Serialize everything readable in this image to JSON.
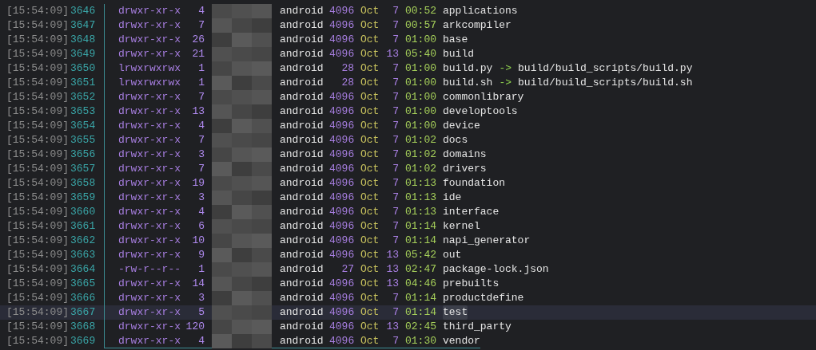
{
  "rows": [
    {
      "time": "[15:54:09]",
      "line": "3646",
      "perms": "drwxr-xr-x",
      "links": "4",
      "owner": "android",
      "size": "4096",
      "month": "Oct",
      "day": "7",
      "clock": "00:52",
      "name": "applications",
      "selected": false
    },
    {
      "time": "[15:54:09]",
      "line": "3647",
      "perms": "drwxr-xr-x",
      "links": "7",
      "owner": "android",
      "size": "4096",
      "month": "Oct",
      "day": "7",
      "clock": "00:57",
      "name": "arkcompiler",
      "selected": false
    },
    {
      "time": "[15:54:09]",
      "line": "3648",
      "perms": "drwxr-xr-x",
      "links": "26",
      "owner": "android",
      "size": "4096",
      "month": "Oct",
      "day": "7",
      "clock": "01:00",
      "name": "base",
      "selected": false
    },
    {
      "time": "[15:54:09]",
      "line": "3649",
      "perms": "drwxr-xr-x",
      "links": "21",
      "owner": "android",
      "size": "4096",
      "month": "Oct",
      "day": "13",
      "clock": "05:40",
      "name": "build",
      "selected": false
    },
    {
      "time": "[15:54:09]",
      "line": "3650",
      "perms": "lrwxrwxrwx",
      "links": "1",
      "owner": "android",
      "size": "28",
      "month": "Oct",
      "day": "7",
      "clock": "01:00",
      "name": "build.py",
      "arrow": "->",
      "target": "build/build_scripts/build.py",
      "selected": false
    },
    {
      "time": "[15:54:09]",
      "line": "3651",
      "perms": "lrwxrwxrwx",
      "links": "1",
      "owner": "android",
      "size": "28",
      "month": "Oct",
      "day": "7",
      "clock": "01:00",
      "name": "build.sh",
      "arrow": "->",
      "target": "build/build_scripts/build.sh",
      "selected": false
    },
    {
      "time": "[15:54:09]",
      "line": "3652",
      "perms": "drwxr-xr-x",
      "links": "7",
      "owner": "android",
      "size": "4096",
      "month": "Oct",
      "day": "7",
      "clock": "01:00",
      "name": "commonlibrary",
      "selected": false
    },
    {
      "time": "[15:54:09]",
      "line": "3653",
      "perms": "drwxr-xr-x",
      "links": "13",
      "owner": "android",
      "size": "4096",
      "month": "Oct",
      "day": "7",
      "clock": "01:00",
      "name": "developtools",
      "selected": false
    },
    {
      "time": "[15:54:09]",
      "line": "3654",
      "perms": "drwxr-xr-x",
      "links": "4",
      "owner": "android",
      "size": "4096",
      "month": "Oct",
      "day": "7",
      "clock": "01:00",
      "name": "device",
      "selected": false
    },
    {
      "time": "[15:54:09]",
      "line": "3655",
      "perms": "drwxr-xr-x",
      "links": "7",
      "owner": "android",
      "size": "4096",
      "month": "Oct",
      "day": "7",
      "clock": "01:02",
      "name": "docs",
      "selected": false
    },
    {
      "time": "[15:54:09]",
      "line": "3656",
      "perms": "drwxr-xr-x",
      "links": "3",
      "owner": "android",
      "size": "4096",
      "month": "Oct",
      "day": "7",
      "clock": "01:02",
      "name": "domains",
      "selected": false
    },
    {
      "time": "[15:54:09]",
      "line": "3657",
      "perms": "drwxr-xr-x",
      "links": "7",
      "owner": "android",
      "size": "4096",
      "month": "Oct",
      "day": "7",
      "clock": "01:02",
      "name": "drivers",
      "selected": false
    },
    {
      "time": "[15:54:09]",
      "line": "3658",
      "perms": "drwxr-xr-x",
      "links": "19",
      "owner": "android",
      "size": "4096",
      "month": "Oct",
      "day": "7",
      "clock": "01:13",
      "name": "foundation",
      "selected": false
    },
    {
      "time": "[15:54:09]",
      "line": "3659",
      "perms": "drwxr-xr-x",
      "links": "3",
      "owner": "android",
      "size": "4096",
      "month": "Oct",
      "day": "7",
      "clock": "01:13",
      "name": "ide",
      "selected": false
    },
    {
      "time": "[15:54:09]",
      "line": "3660",
      "perms": "drwxr-xr-x",
      "links": "4",
      "owner": "android",
      "size": "4096",
      "month": "Oct",
      "day": "7",
      "clock": "01:13",
      "name": "interface",
      "selected": false
    },
    {
      "time": "[15:54:09]",
      "line": "3661",
      "perms": "drwxr-xr-x",
      "links": "6",
      "owner": "android",
      "size": "4096",
      "month": "Oct",
      "day": "7",
      "clock": "01:14",
      "name": "kernel",
      "selected": false
    },
    {
      "time": "[15:54:09]",
      "line": "3662",
      "perms": "drwxr-xr-x",
      "links": "10",
      "owner": "android",
      "size": "4096",
      "month": "Oct",
      "day": "7",
      "clock": "01:14",
      "name": "napi_generator",
      "selected": false
    },
    {
      "time": "[15:54:09]",
      "line": "3663",
      "perms": "drwxr-xr-x",
      "links": "9",
      "owner": "android",
      "size": "4096",
      "month": "Oct",
      "day": "13",
      "clock": "05:42",
      "name": "out",
      "selected": false
    },
    {
      "time": "[15:54:09]",
      "line": "3664",
      "perms": "-rw-r--r--",
      "links": "1",
      "owner": "android",
      "size": "27",
      "month": "Oct",
      "day": "13",
      "clock": "02:47",
      "name": "package-lock.json",
      "selected": false
    },
    {
      "time": "[15:54:09]",
      "line": "3665",
      "perms": "drwxr-xr-x",
      "links": "14",
      "owner": "android",
      "size": "4096",
      "month": "Oct",
      "day": "13",
      "clock": "04:46",
      "name": "prebuilts",
      "selected": false
    },
    {
      "time": "[15:54:09]",
      "line": "3666",
      "perms": "drwxr-xr-x",
      "links": "3",
      "owner": "android",
      "size": "4096",
      "month": "Oct",
      "day": "7",
      "clock": "01:14",
      "name": "productdefine",
      "selected": false
    },
    {
      "time": "[15:54:09]",
      "line": "3667",
      "perms": "drwxr-xr-x",
      "links": "5",
      "owner": "android",
      "size": "4096",
      "month": "Oct",
      "day": "7",
      "clock": "01:14",
      "name": "test",
      "selected": true
    },
    {
      "time": "[15:54:09]",
      "line": "3668",
      "perms": "drwxr-xr-x",
      "links": "120",
      "owner": "android",
      "size": "4096",
      "month": "Oct",
      "day": "13",
      "clock": "02:45",
      "name": "third_party",
      "selected": false
    },
    {
      "time": "[15:54:09]",
      "line": "3669",
      "perms": "drwxr-xr-x",
      "links": "4",
      "owner": "android",
      "size": "4096",
      "month": "Oct",
      "day": "7",
      "clock": "01:30",
      "name": "vendor",
      "selected": false
    }
  ]
}
